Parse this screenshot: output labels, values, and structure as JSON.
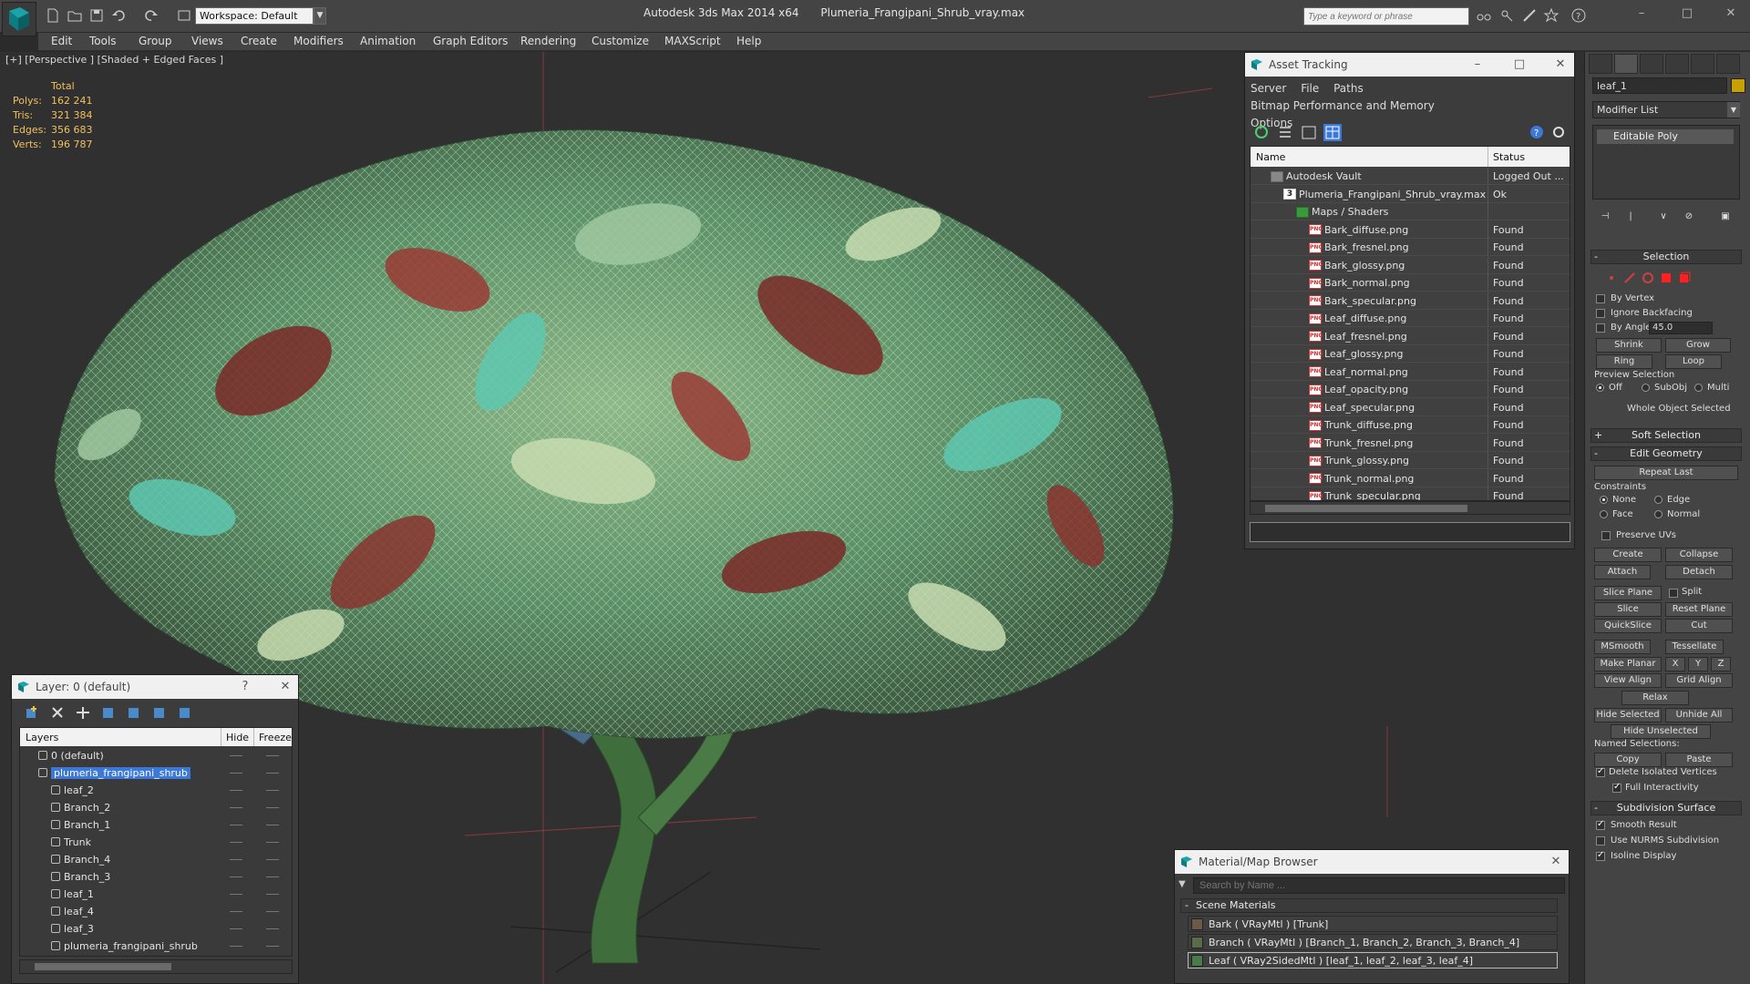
{
  "window": {
    "app_title": "Autodesk 3ds Max  2014 x64",
    "file_title": "Plumeria_Frangipani_Shrub_vray.max",
    "workspace": "Workspace: Default",
    "search_placeholder": "Type a keyword or phrase"
  },
  "menu": [
    "Edit",
    "Tools",
    "Group",
    "Views",
    "Create",
    "Modifiers",
    "Animation",
    "Graph Editors",
    "Rendering",
    "Customize",
    "MAXScript",
    "Help"
  ],
  "viewport": {
    "label": "[+] [Perspective ] [Shaded + Edged Faces ]",
    "stats": {
      "total_label": "Total",
      "rows": [
        {
          "label": "Polys:",
          "value": "162 241"
        },
        {
          "label": "Tris:",
          "value": "321 384"
        },
        {
          "label": "Edges:",
          "value": "356 683"
        },
        {
          "label": "Verts:",
          "value": "196 787"
        }
      ]
    }
  },
  "asset_tracking": {
    "title": "Asset Tracking",
    "menu": [
      "Server",
      "File",
      "Paths",
      "Bitmap Performance and Memory",
      "Options"
    ],
    "columns": {
      "name": "Name",
      "status": "Status"
    },
    "rows": [
      {
        "name": "Autodesk Vault",
        "status": "Logged Out ...",
        "level": 0,
        "icon": "vault"
      },
      {
        "name": "Plumeria_Frangipani_Shrub_vray.max",
        "status": "Ok",
        "level": 1,
        "icon": "max"
      },
      {
        "name": "Maps / Shaders",
        "status": "",
        "level": 2,
        "icon": "maps"
      },
      {
        "name": "Bark_diffuse.png",
        "status": "Found",
        "level": 3,
        "icon": "png"
      },
      {
        "name": "Bark_fresnel.png",
        "status": "Found",
        "level": 3,
        "icon": "png"
      },
      {
        "name": "Bark_glossy.png",
        "status": "Found",
        "level": 3,
        "icon": "png"
      },
      {
        "name": "Bark_normal.png",
        "status": "Found",
        "level": 3,
        "icon": "png"
      },
      {
        "name": "Bark_specular.png",
        "status": "Found",
        "level": 3,
        "icon": "png"
      },
      {
        "name": "Leaf_diffuse.png",
        "status": "Found",
        "level": 3,
        "icon": "png"
      },
      {
        "name": "Leaf_fresnel.png",
        "status": "Found",
        "level": 3,
        "icon": "png"
      },
      {
        "name": "Leaf_glossy.png",
        "status": "Found",
        "level": 3,
        "icon": "png"
      },
      {
        "name": "Leaf_normal.png",
        "status": "Found",
        "level": 3,
        "icon": "png"
      },
      {
        "name": "Leaf_opacity.png",
        "status": "Found",
        "level": 3,
        "icon": "png"
      },
      {
        "name": "Leaf_specular.png",
        "status": "Found",
        "level": 3,
        "icon": "png"
      },
      {
        "name": "Trunk_diffuse.png",
        "status": "Found",
        "level": 3,
        "icon": "png"
      },
      {
        "name": "Trunk_fresnel.png",
        "status": "Found",
        "level": 3,
        "icon": "png"
      },
      {
        "name": "Trunk_glossy.png",
        "status": "Found",
        "level": 3,
        "icon": "png"
      },
      {
        "name": "Trunk_normal.png",
        "status": "Found",
        "level": 3,
        "icon": "png"
      },
      {
        "name": "Trunk_specular.png",
        "status": "Found",
        "level": 3,
        "icon": "png"
      }
    ]
  },
  "command_panel": {
    "object_name": "leaf_1",
    "object_color": "#c8a000",
    "modifier_list": "Modifier List",
    "stack_item": "Editable Poly",
    "selection": {
      "title": "Selection",
      "by_vertex": "By Vertex",
      "ignore_backfacing": "Ignore Backfacing",
      "by_angle": "By Angle:",
      "angle_value": "45.0",
      "shrink": "Shrink",
      "grow": "Grow",
      "ring": "Ring",
      "loop": "Loop",
      "preview_selection": "Preview Selection",
      "off": "Off",
      "subobj": "SubObj",
      "multi": "Multi",
      "status": "Whole Object Selected"
    },
    "soft_selection": "Soft Selection",
    "edit_geometry": {
      "title": "Edit Geometry",
      "repeat_last": "Repeat Last",
      "constraints": "Constraints",
      "none": "None",
      "edge": "Edge",
      "face": "Face",
      "normal": "Normal",
      "preserve_uvs": "Preserve UVs",
      "create": "Create",
      "collapse": "Collapse",
      "attach": "Attach",
      "detach": "Detach",
      "slice_plane": "Slice Plane",
      "split": "Split",
      "slice": "Slice",
      "reset_plane": "Reset Plane",
      "quickslice": "QuickSlice",
      "cut": "Cut",
      "msmooth": "MSmooth",
      "tessellate": "Tessellate",
      "make_planar": "Make Planar",
      "x": "X",
      "y": "Y",
      "z": "Z",
      "view_align": "View Align",
      "grid_align": "Grid Align",
      "relax": "Relax",
      "hide_selected": "Hide Selected",
      "unhide_all": "Unhide All",
      "hide_unselected": "Hide Unselected",
      "named_selections": "Named Selections:",
      "copy": "Copy",
      "paste": "Paste",
      "delete_isolated": "Delete Isolated Vertices",
      "full_interactivity": "Full Interactivity"
    },
    "subdivision": {
      "title": "Subdivision Surface",
      "smooth_result": "Smooth Result",
      "use_nurms": "Use NURMS Subdivision",
      "isoline_display": "Isoline Display"
    }
  },
  "layer_panel": {
    "title": "Layer: 0 (default)",
    "columns": {
      "layers": "Layers",
      "hide": "Hide",
      "freeze": "Freeze"
    },
    "rows": [
      {
        "name": "0 (default)",
        "level": 0,
        "type": "layer"
      },
      {
        "name": "plumeria_frangipani_shrub",
        "level": 0,
        "type": "layer",
        "selected": true
      },
      {
        "name": "leaf_2",
        "level": 1,
        "type": "object"
      },
      {
        "name": "Branch_2",
        "level": 1,
        "type": "object"
      },
      {
        "name": "Branch_1",
        "level": 1,
        "type": "object"
      },
      {
        "name": "Trunk",
        "level": 1,
        "type": "object"
      },
      {
        "name": "Branch_4",
        "level": 1,
        "type": "object"
      },
      {
        "name": "Branch_3",
        "level": 1,
        "type": "object"
      },
      {
        "name": "leaf_1",
        "level": 1,
        "type": "object"
      },
      {
        "name": "leaf_4",
        "level": 1,
        "type": "object"
      },
      {
        "name": "leaf_3",
        "level": 1,
        "type": "object"
      },
      {
        "name": "plumeria_frangipani_shrub",
        "level": 1,
        "type": "object"
      }
    ]
  },
  "material_browser": {
    "title": "Material/Map Browser",
    "search_placeholder": "Search by Name ...",
    "section": "Scene Materials",
    "items": [
      {
        "label": "Bark  ( VRayMtl ) [Trunk]",
        "swatch": "#6b5a48"
      },
      {
        "label": "Branch  ( VRayMtl ) [Branch_1, Branch_2, Branch_3, Branch_4]",
        "swatch": "#5a6b48"
      },
      {
        "label": "Leaf  ( VRay2SidedMtl ) [leaf_1, leaf_2, leaf_3, leaf_4]",
        "swatch": "#4a7a4a"
      }
    ]
  }
}
